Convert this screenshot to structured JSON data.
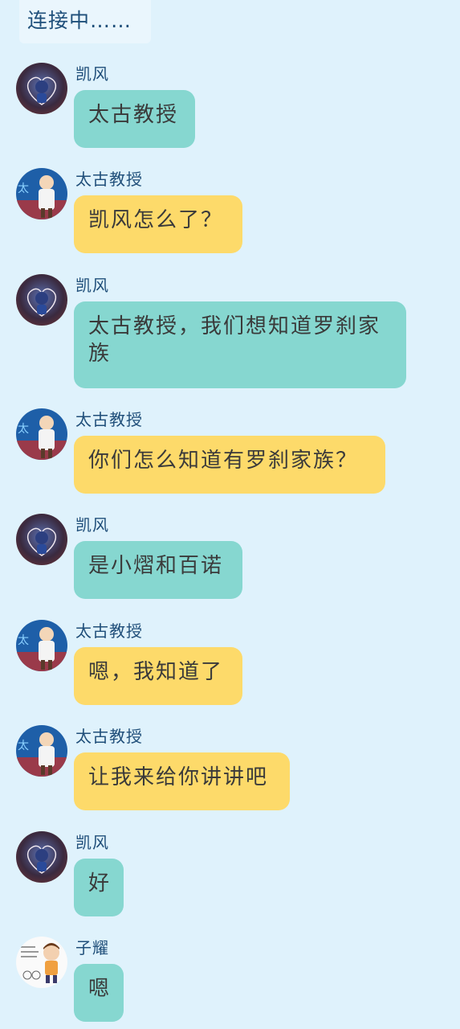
{
  "status": {
    "connecting_text": "连接中……"
  },
  "colors": {
    "background": "#dff2fc",
    "bubble_kaifeng": "#86d7d0",
    "bubble_taigu": "#fdda6a",
    "bubble_ziyao": "#86d7d0",
    "sender_name": "#1f4e79"
  },
  "messages": [
    {
      "sender": "凯风",
      "text": "太古教授",
      "avatar": "kaifeng-avatar"
    },
    {
      "sender": "太古教授",
      "text": "凯风怎么了？",
      "avatar": "taigu-avatar"
    },
    {
      "sender": "凯风",
      "text": "太古教授，我们想知道罗刹家族",
      "avatar": "kaifeng-avatar"
    },
    {
      "sender": "太古教授",
      "text": "你们怎么知道有罗刹家族？",
      "avatar": "taigu-avatar"
    },
    {
      "sender": "凯风",
      "text": "是小熠和百诺",
      "avatar": "kaifeng-avatar"
    },
    {
      "sender": "太古教授",
      "text": "嗯，我知道了",
      "avatar": "taigu-avatar"
    },
    {
      "sender": "太古教授",
      "text": "让我来给你讲讲吧",
      "avatar": "taigu-avatar"
    },
    {
      "sender": "凯风",
      "text": "好",
      "avatar": "kaifeng-avatar"
    },
    {
      "sender": "子耀",
      "text": "嗯",
      "avatar": "ziyao-avatar"
    }
  ]
}
